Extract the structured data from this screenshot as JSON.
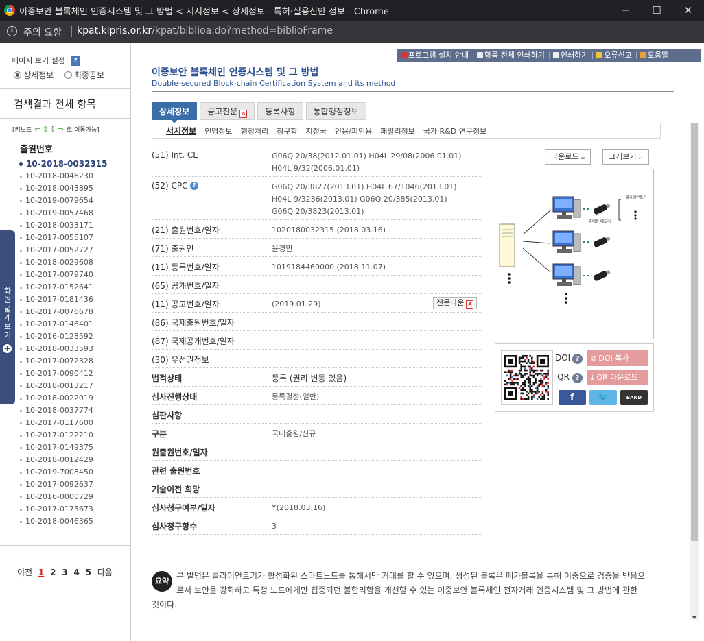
{
  "window": {
    "title": "이중보안 블록체인 인증시스템 및 그 방법 < 서지정보 < 상세정보 - 특허·실용신안 정보 - Chrome",
    "minimize": "─",
    "maximize": "☐",
    "close": "✕"
  },
  "addressbar": {
    "warning": "주의 요함",
    "url_host": "kpat.kipris.or.kr",
    "url_path": "/kpat/biblioa.do?method=biblioFrame"
  },
  "sidebar": {
    "view_settings": "페이지 보기 설정",
    "help": "?",
    "radio_detail": "상세정보",
    "radio_final": "최종공보",
    "results_title": "검색결과 전체 항목",
    "keyboard_hint_prefix": "[키보드",
    "keyboard_hint_suffix": "로 이동가능]",
    "appno_title": "출원번호",
    "expand_label": "화면넓게보기",
    "expand_plus": "+",
    "items": [
      "10-2018-0032315",
      "10-2018-0046230",
      "10-2018-0043895",
      "10-2019-0079654",
      "10-2019-0057468",
      "10-2018-0033171",
      "10-2017-0055107",
      "10-2017-0052727",
      "10-2018-0029608",
      "10-2017-0079740",
      "10-2017-0152641",
      "10-2017-0181436",
      "10-2017-0076678",
      "10-2017-0146401",
      "10-2016-0128592",
      "10-2018-0033593",
      "10-2017-0072328",
      "10-2017-0090412",
      "10-2018-0013217",
      "10-2018-0022019",
      "10-2018-0037774",
      "10-2017-0117600",
      "10-2017-0122210",
      "10-2017-0149375",
      "10-2018-0012429",
      "10-2019-7008450",
      "10-2017-0092637",
      "10-2016-0000729",
      "10-2017-0175673",
      "10-2018-0046365"
    ],
    "pager": {
      "prev": "이전",
      "pages": [
        "1",
        "2",
        "3",
        "4",
        "5"
      ],
      "next": "다음"
    }
  },
  "topmenu": [
    "프로그램 설치 안내",
    "항목 전체 인쇄하기",
    "인쇄하기",
    "오류신고",
    "도움말"
  ],
  "doc": {
    "title": "이중보안 블록체인 인증시스템 및 그 방법",
    "subtitle": "Double-secured Block-chain Certification System and its method"
  },
  "tabs": [
    "상세정보",
    "공고전문",
    "등록사항",
    "통합행정정보"
  ],
  "subtabs": [
    "서지정보",
    "인명정보",
    "행정처리",
    "청구항",
    "지정국",
    "인용/피인용",
    "패밀리정보",
    "국가 R&D 연구정보"
  ],
  "fields": [
    {
      "k": "(51) Int. CL",
      "v": [
        "G06Q 20/38(2012.01.01) H04L 29/08(2006.01.01)",
        "H04L 9/32(2006.01.01)"
      ]
    },
    {
      "k": "(52) CPC",
      "v": [
        "G06Q 20/3827(2013.01) H04L 67/1046(2013.01)",
        "H04L 9/3236(2013.01) G06Q 20/385(2013.01)",
        "G06Q 20/3823(2013.01)"
      ]
    },
    {
      "k": "(21) 출원번호/일자",
      "v": [
        "1020180032315 (2018.03.16)"
      ]
    },
    {
      "k": "(71) 출원인",
      "v": [
        "윤경민"
      ]
    },
    {
      "k": "(11) 등록번호/일자",
      "v": [
        "1019184460000 (2018.11.07)"
      ]
    },
    {
      "k": "(65) 공개번호/일자",
      "v": []
    },
    {
      "k": "(11) 공고번호/일자",
      "v": [
        "(2019.01.29)"
      ]
    },
    {
      "k": "(86) 국제출원번호/일자",
      "v": []
    },
    {
      "k": "(87) 국제공개번호/일자",
      "v": []
    },
    {
      "k": "(30) 우선권정보",
      "v": []
    },
    {
      "k": "법적상태",
      "v": [
        "등록 (권리 변동 있음)"
      ]
    },
    {
      "k": "심사진행상태",
      "v": [
        "등록결정(일반)"
      ]
    },
    {
      "k": "심판사항",
      "v": []
    },
    {
      "k": "구분",
      "v": [
        "국내출원/신규"
      ]
    },
    {
      "k": "원출원번호/일자",
      "v": []
    },
    {
      "k": "관련 출원번호",
      "v": []
    },
    {
      "k": "기술이전 희망",
      "v": []
    },
    {
      "k": "심사청구여부/일자",
      "v": [
        "Y(2018.03.16)"
      ]
    },
    {
      "k": "심사청구항수",
      "v": [
        "3"
      ]
    }
  ],
  "fulltext_btn": "전문다운",
  "download_btn": "다운로드",
  "zoom_btn": "크게보기",
  "figure_labels": {
    "client": "클라이언트키",
    "usb": "휴대용 메모리"
  },
  "qr": {
    "doi_label": "DOI",
    "qr_label": "QR",
    "doi_copy": "DOI 복사",
    "qr_download": "QR 다운로드",
    "facebook": "f",
    "band": "BAND"
  },
  "abstract": {
    "badge": "요약",
    "line1": "본 발명은 클라이언트키가 활성화된 스마트노드를 통해서만 거래를 할 수 있으며, 생성된 블록은 메가블록을 통해 이중으로 검증을 받음으",
    "line2": "로서 보안을 강화하고 특정 노드에게만 집중되던 불합리함을 개선할 수 있는 이중보안 블록체인 전자거래 인증시스템 및 그 방법에 관한",
    "line3": "것이다."
  }
}
